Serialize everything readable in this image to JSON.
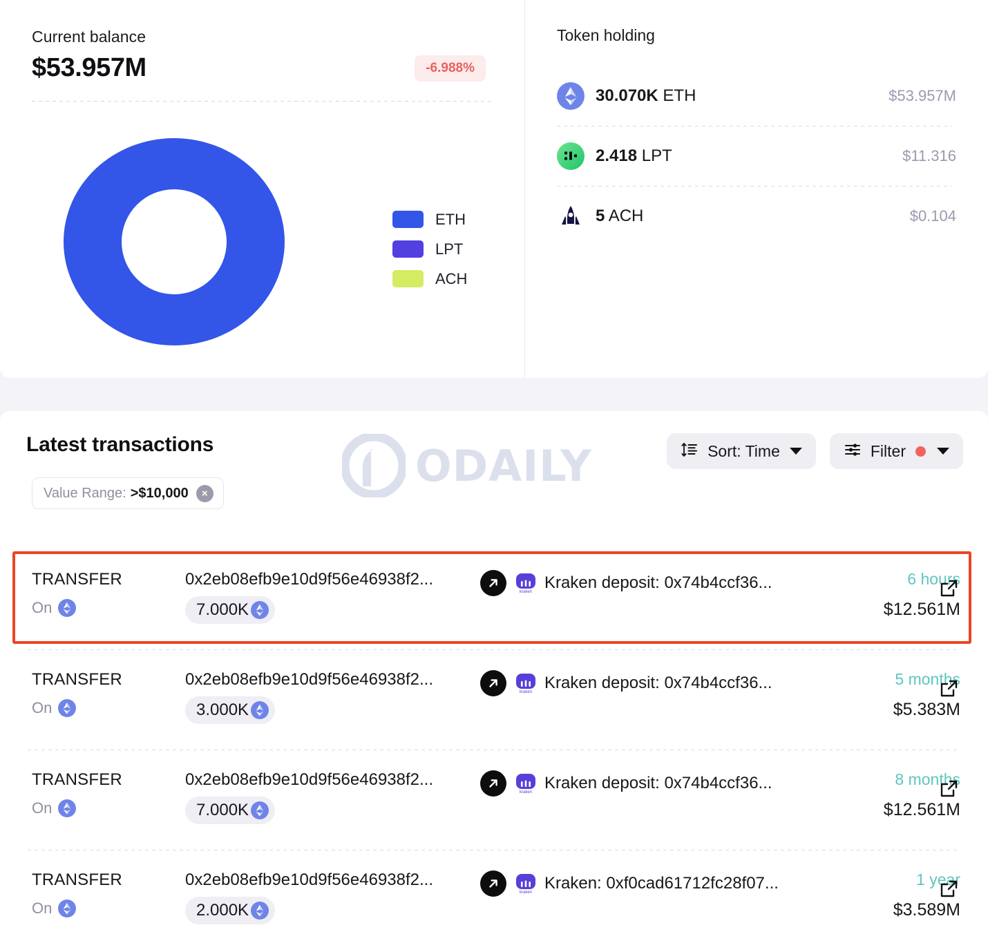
{
  "balance_panel": {
    "title": "Current balance",
    "amount": "$53.957M",
    "change": "-6.988%",
    "change_color": "#e8615f",
    "legend": [
      {
        "label": "ETH",
        "color": "#3355e8"
      },
      {
        "label": "LPT",
        "color": "#5240e0"
      },
      {
        "label": "ACH",
        "color": "#d4ec62"
      }
    ]
  },
  "chart_data": {
    "type": "pie",
    "title": "Current balance",
    "labels": [
      "ETH",
      "LPT",
      "ACH"
    ],
    "values": [
      53957000,
      11.316,
      0.104
    ],
    "percentages": [
      99.99998,
      2e-05,
      2e-07
    ],
    "colors": [
      "#3355e8",
      "#5240e0",
      "#d4ec62"
    ],
    "donut": true,
    "legend_position": "right"
  },
  "token_panel": {
    "title": "Token holding",
    "rows": [
      {
        "icon": "eth-token-icon",
        "amount": "30.070K",
        "symbol": "ETH",
        "value": "$53.957M"
      },
      {
        "icon": "lpt-token-icon",
        "amount": "2.418",
        "symbol": "LPT",
        "value": "$11.316"
      },
      {
        "icon": "ach-token-icon",
        "amount": "5",
        "symbol": "ACH",
        "value": "$0.104"
      }
    ]
  },
  "transactions_panel": {
    "title": "Latest transactions",
    "filter_chip": {
      "key": "Value Range:",
      "value": ">$10,000",
      "clear": "×"
    },
    "sort_button": {
      "label": "Sort: Time",
      "icon": "sort-icon",
      "caret": "chevron-down-icon"
    },
    "filter_button": {
      "label": "Filter",
      "icon": "filter-icon",
      "dot_color": "#f2635c",
      "caret": "chevron-down-icon"
    },
    "watermark": "ODAILY",
    "rows": [
      {
        "type": "TRANSFER",
        "on_label": "On",
        "chain_icon": "eth-chain-icon",
        "from": "0x2eb08efb9e10d9f56e46938f2...",
        "amount": "7.000K",
        "amount_icon": "eth-token-icon",
        "to_icon": "kraken-icon",
        "to": "Kraken deposit: 0x74b4ccf36...",
        "time": "6 hours",
        "usd": "$12.561M",
        "highlighted": true
      },
      {
        "type": "TRANSFER",
        "on_label": "On",
        "chain_icon": "eth-chain-icon",
        "from": "0x2eb08efb9e10d9f56e46938f2...",
        "amount": "3.000K",
        "amount_icon": "eth-token-icon",
        "to_icon": "kraken-icon",
        "to": "Kraken deposit: 0x74b4ccf36...",
        "time": "5 months",
        "usd": "$5.383M",
        "highlighted": false
      },
      {
        "type": "TRANSFER",
        "on_label": "On",
        "chain_icon": "eth-chain-icon",
        "from": "0x2eb08efb9e10d9f56e46938f2...",
        "amount": "7.000K",
        "amount_icon": "eth-token-icon",
        "to_icon": "kraken-icon",
        "to": "Kraken deposit: 0x74b4ccf36...",
        "time": "8 months",
        "usd": "$12.561M",
        "highlighted": false
      },
      {
        "type": "TRANSFER",
        "on_label": "On",
        "chain_icon": "eth-chain-icon",
        "from": "0x2eb08efb9e10d9f56e46938f2...",
        "amount": "2.000K",
        "amount_icon": "eth-token-icon",
        "to_icon": "kraken-icon",
        "to": "Kraken: 0xf0cad61712fc28f07...",
        "time": "1 year",
        "usd": "$3.589M",
        "highlighted": false
      }
    ]
  }
}
